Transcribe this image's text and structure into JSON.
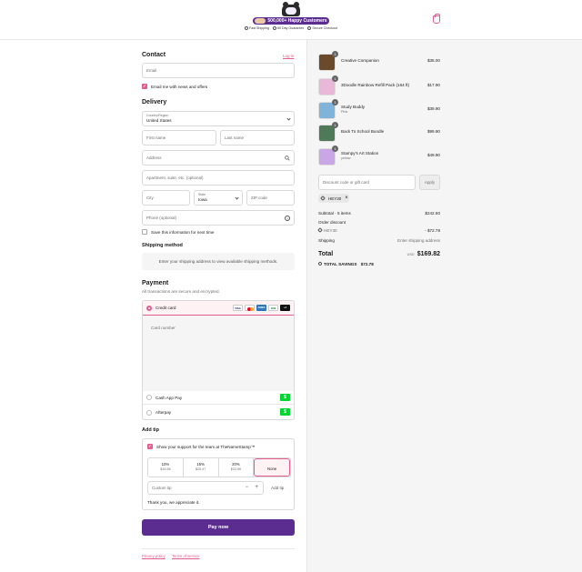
{
  "header": {
    "brand_badge": "500,000+ Happy Customers",
    "trust_badges": [
      "Fast Shipping",
      "60 Day Guarantee",
      "Secure Checkout"
    ]
  },
  "contact": {
    "title": "Contact",
    "login_link": "Log in",
    "email_placeholder": "Email",
    "news_label": "Email me with news and offers"
  },
  "delivery": {
    "title": "Delivery",
    "country_label": "Country/Region",
    "country_value": "United States",
    "first_name": "First name",
    "last_name": "Last name",
    "address": "Address",
    "apartment": "Apartment, suite, etc. (optional)",
    "city": "City",
    "state_label": "State",
    "state_value": "Iowa",
    "zip": "ZIP code",
    "phone": "Phone (optional)",
    "save_label": "Save this information for next time"
  },
  "shipping_method": {
    "title": "Shipping method",
    "message": "Enter your shipping address to view available shipping methods."
  },
  "payment": {
    "title": "Payment",
    "subtitle": "All transactions are secure and encrypted.",
    "credit_card": "Credit card",
    "card_logos": [
      "VISA",
      "MC",
      "AMEX",
      "JCB",
      "+4"
    ],
    "card_number": "Card number",
    "cashapp": "Cash App Pay",
    "afterpay": "Afterpay"
  },
  "tip": {
    "title": "Add tip",
    "support_label": "Show your support for the team at TheNameStamp™",
    "options": [
      {
        "pct": "10%",
        "amt": "$16.98"
      },
      {
        "pct": "15%",
        "amt": "$25.47"
      },
      {
        "pct": "20%",
        "amt": "$33.96"
      },
      {
        "pct": "None",
        "amt": ""
      }
    ],
    "custom_placeholder": "Custom tip",
    "add_button": "Add tip",
    "thanks": "Thank you, we appreciate it."
  },
  "pay_button": "Pay now",
  "footer_links": [
    "Privacy policy",
    "Terms of service"
  ],
  "cart": {
    "items": [
      {
        "name": "Creative Companion",
        "variant": "",
        "price": "$35.00",
        "qty": "1",
        "color": "#6a4a2a"
      },
      {
        "name": "3Doodle Rainbow Refill Pack (164 ft)",
        "variant": "",
        "price": "$17.90",
        "qty": "1",
        "color": "#e9b8d8"
      },
      {
        "name": "Study Buddy",
        "variant": "Pink",
        "price": "$39.90",
        "qty": "1",
        "color": "#7fb3d9"
      },
      {
        "name": "Back To School Bundle",
        "variant": "",
        "price": "$99.90",
        "qty": "1",
        "color": "#4e7a5a"
      },
      {
        "name": "Stampy's Art Station",
        "variant": "yellow",
        "price": "$49.90",
        "qty": "1",
        "color": "#c9a6e6"
      }
    ],
    "discount_placeholder": "Discount code or gift card",
    "apply": "Apply",
    "code": "HEY30",
    "subtotal_label": "Subtotal · 5 items",
    "subtotal": "$242.60",
    "order_discount_label": "Order discount",
    "discount_code": "HEY30",
    "discount_value": "- $72.78",
    "shipping_label": "Shipping",
    "shipping_value": "Enter shipping address",
    "total_label": "Total",
    "currency": "USD",
    "total": "$169.82",
    "savings_label": "TOTAL SAVINGS",
    "savings": "$72.78"
  }
}
